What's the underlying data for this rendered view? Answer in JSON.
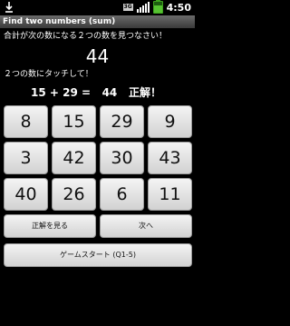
{
  "status_bar": {
    "network": "3G",
    "time": "4:50",
    "icons": [
      "download-icon",
      "signal-icon",
      "battery-icon"
    ]
  },
  "app": {
    "title": "Find two numbers (sum)"
  },
  "quiz": {
    "instruction": "合計が次の数になる２つの数を見つなさい！",
    "target": "44",
    "touch_prompt": "２つの数にタッチして！",
    "equation": "15 + 29 =   44",
    "result": "正解！"
  },
  "numbers": [
    "8",
    "15",
    "29",
    "9",
    "3",
    "42",
    "30",
    "43",
    "40",
    "26",
    "6",
    "11"
  ],
  "actions": {
    "show_answer": "正解を見る",
    "next": "次へ",
    "start_game": "ゲームスタート (Q1-5)"
  },
  "colors": {
    "background": "#000000",
    "button": "#e6e6e6",
    "titlebar": "#555555",
    "battery": "#56c231"
  }
}
